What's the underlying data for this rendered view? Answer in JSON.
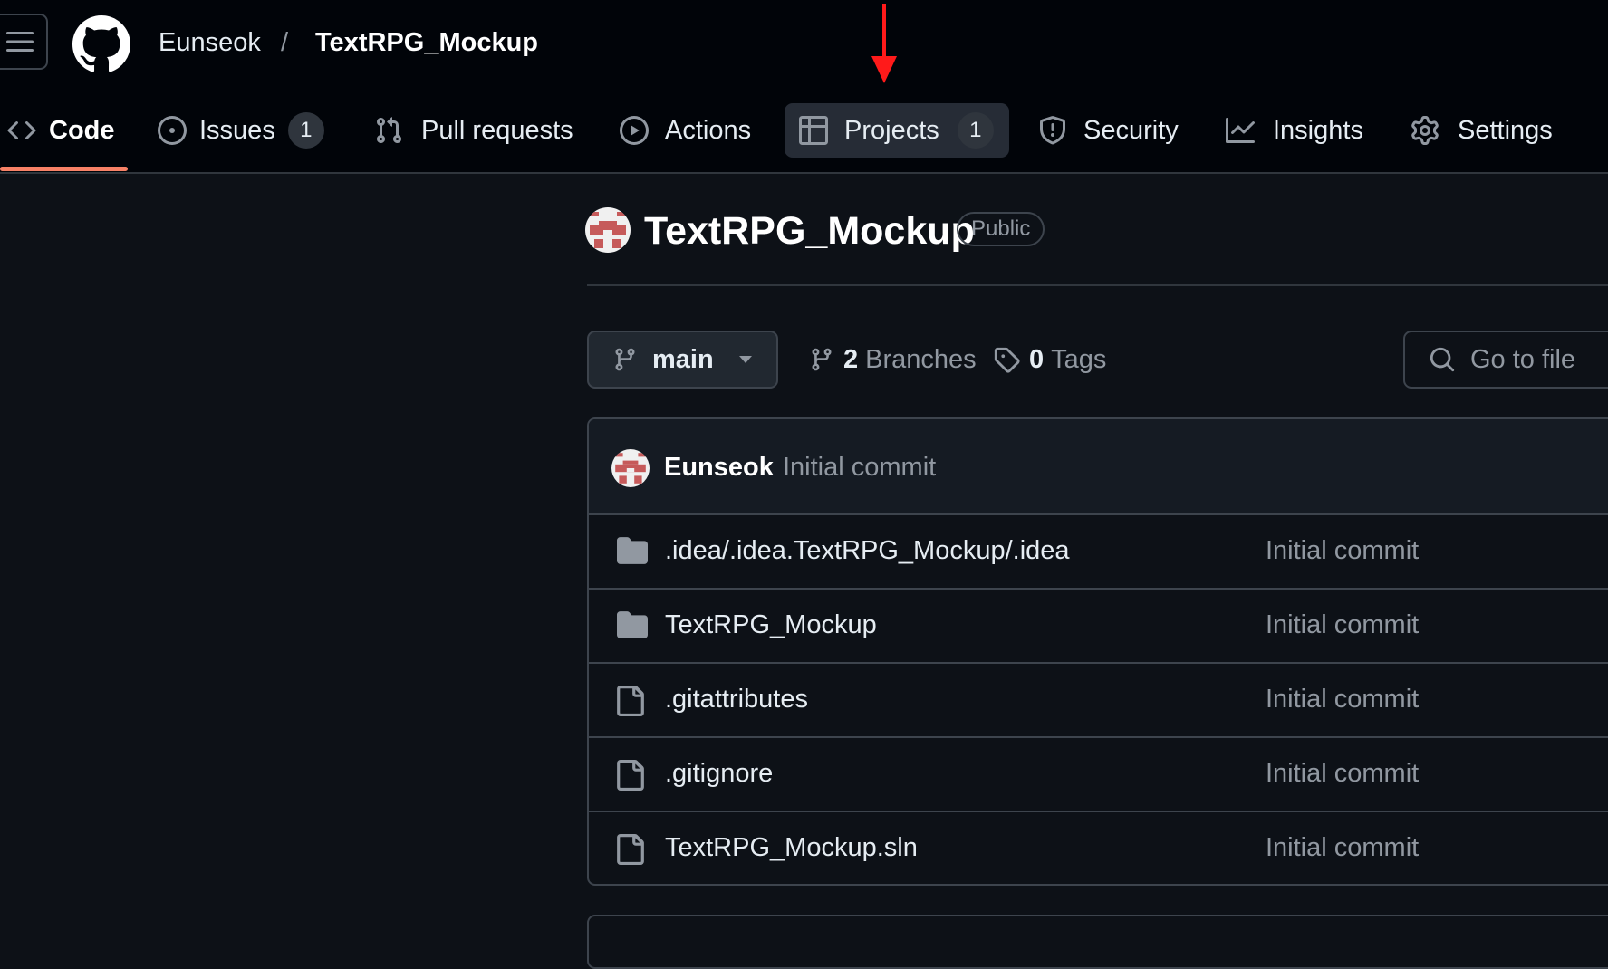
{
  "header": {
    "owner": "Eunseok",
    "separator": "/",
    "repo": "TextRPG_Mockup"
  },
  "tabs": [
    {
      "label": "Code",
      "icon": "code-icon",
      "selected": true
    },
    {
      "label": "Issues",
      "icon": "issue-opened-icon",
      "count": "1"
    },
    {
      "label": "Pull requests",
      "icon": "git-pull-request-icon"
    },
    {
      "label": "Actions",
      "icon": "play-icon"
    },
    {
      "label": "Projects",
      "icon": "table-icon",
      "count": "1",
      "highlighted": true
    },
    {
      "label": "Security",
      "icon": "shield-icon"
    },
    {
      "label": "Insights",
      "icon": "graph-icon"
    },
    {
      "label": "Settings",
      "icon": "gear-icon"
    }
  ],
  "repo": {
    "title": "TextRPG_Mockup",
    "visibility": "Public"
  },
  "toolbar": {
    "branch": "main",
    "branches_count": "2",
    "branches_label": "Branches",
    "tags_count": "0",
    "tags_label": "Tags",
    "goto_file_placeholder": "Go to file"
  },
  "latest_commit": {
    "author": "Eunseok",
    "message": "Initial commit"
  },
  "files": [
    {
      "name": ".idea/.idea.TextRPG_Mockup/.idea",
      "type": "folder",
      "commit": "Initial commit"
    },
    {
      "name": "TextRPG_Mockup",
      "type": "folder",
      "commit": "Initial commit"
    },
    {
      "name": ".gitattributes",
      "type": "file",
      "commit": "Initial commit"
    },
    {
      "name": ".gitignore",
      "type": "file",
      "commit": "Initial commit"
    },
    {
      "name": "TextRPG_Mockup.sln",
      "type": "file",
      "commit": "Initial commit"
    }
  ],
  "colors": {
    "background": "#0d1117",
    "header_background": "#010409",
    "selected_tab_underline": "#f78166",
    "annotation_arrow": "#ff1a1a",
    "avatar_accent": "#c65a5a"
  }
}
